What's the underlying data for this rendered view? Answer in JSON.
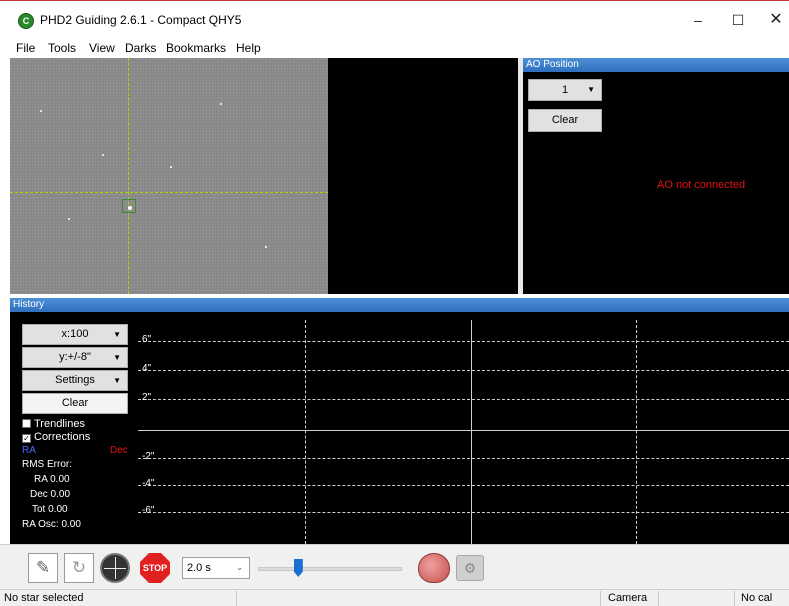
{
  "window": {
    "app_icon": "C",
    "title": "PHD2 Guiding 2.6.1 - Compact QHY5",
    "minimize": "–",
    "maximize": "☐",
    "close": "✕"
  },
  "menu": [
    "File",
    "Tools",
    "View",
    "Darks",
    "Bookmarks",
    "Help"
  ],
  "ao_panel": {
    "header": "AO Position",
    "select_value": "1",
    "clear_label": "Clear",
    "status": "AO not connected",
    "status_color": "#e01010"
  },
  "history": {
    "header": "History",
    "x_scale": "x:100",
    "y_scale": "y:+/-8\"",
    "settings_label": "Settings",
    "clear_label": "Clear",
    "trendlines_label": "Trendlines",
    "trendlines_checked": false,
    "corrections_label": "Corrections",
    "corrections_checked": true,
    "ra_legend": "RA",
    "ra_color": "#4a6dff",
    "dec_legend": "Dec",
    "dec_color": "#e01010",
    "rms_label": "RMS Error:",
    "rms_ra": "RA 0.00",
    "rms_dec": "Dec 0.00",
    "rms_tot": "Tot 0.00",
    "ra_osc": "RA Osc: 0.00",
    "y_ticks": [
      "6\"",
      "4\"",
      "2\"",
      "-2\"",
      "-4\"",
      "-6\""
    ]
  },
  "toolbar": {
    "loop_icon": "✎",
    "guide_loop_icon": "↻",
    "stop_label": "STOP",
    "exposure": "2.0 s",
    "exposure_chevron": "⌄",
    "slider_value": 0.28,
    "camera_settings_icon": "⚙"
  },
  "status": {
    "message": "No star selected",
    "camera": "Camera",
    "calibration": "No cal"
  },
  "icons": {
    "app": "phd2-app-icon",
    "loop": "pencil-icon",
    "guide_loop": "refresh-icon",
    "target": "target-icon",
    "stop": "stop-icon",
    "brain": "brain-icon",
    "camera_settings": "camera-settings-icon"
  }
}
